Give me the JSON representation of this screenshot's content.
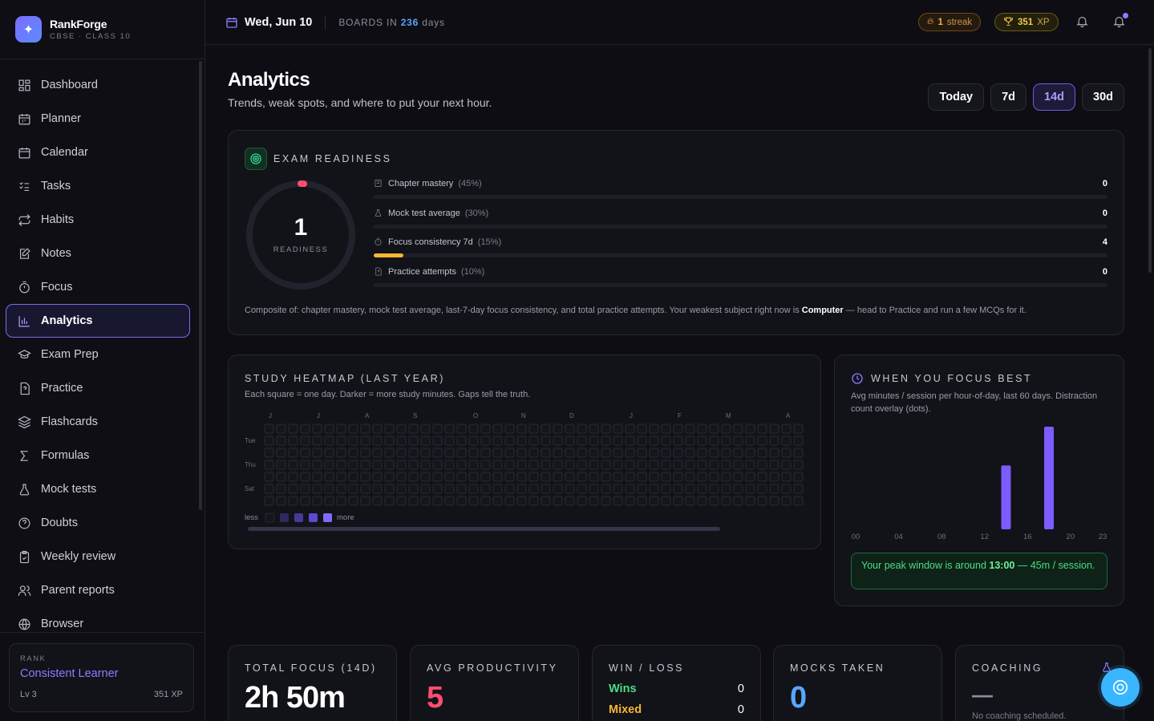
{
  "brand": {
    "name": "RankForge",
    "sub": "CBSE · CLASS 10"
  },
  "sidebar": {
    "items": [
      {
        "label": "Dashboard",
        "icon": "dashboard-icon"
      },
      {
        "label": "Planner",
        "icon": "planner-icon"
      },
      {
        "label": "Calendar",
        "icon": "calendar-icon"
      },
      {
        "label": "Tasks",
        "icon": "tasks-icon"
      },
      {
        "label": "Habits",
        "icon": "habits-icon"
      },
      {
        "label": "Notes",
        "icon": "notes-icon"
      },
      {
        "label": "Focus",
        "icon": "timer-icon"
      },
      {
        "label": "Analytics",
        "icon": "analytics-icon",
        "active": true
      },
      {
        "label": "Exam Prep",
        "icon": "graduation-cap-icon"
      },
      {
        "label": "Practice",
        "icon": "question-file-icon"
      },
      {
        "label": "Flashcards",
        "icon": "layers-icon"
      },
      {
        "label": "Formulas",
        "icon": "sigma-icon"
      },
      {
        "label": "Mock tests",
        "icon": "flask-icon"
      },
      {
        "label": "Doubts",
        "icon": "help-circle-icon"
      },
      {
        "label": "Weekly review",
        "icon": "clipboard-check-icon"
      },
      {
        "label": "Parent reports",
        "icon": "users-icon"
      },
      {
        "label": "Browser",
        "icon": "globe-icon"
      }
    ]
  },
  "rank": {
    "label": "RANK",
    "name": "Consistent Learner",
    "level": "Lv 3",
    "xp": "351 XP"
  },
  "topbar": {
    "date": "Wed, Jun 10",
    "boards_prefix": "BOARDS IN",
    "boards_days": "236",
    "boards_suffix": "days",
    "streak_count": "1",
    "streak_label": "streak",
    "xp_count": "351",
    "xp_label": "XP"
  },
  "page": {
    "title": "Analytics",
    "subtitle": "Trends, weak spots, and where to put your next hour."
  },
  "ranges": [
    {
      "label": "Today",
      "active": false
    },
    {
      "label": "7d",
      "active": false
    },
    {
      "label": "14d",
      "active": true
    },
    {
      "label": "30d",
      "active": false
    }
  ],
  "readiness": {
    "title": "EXAM READINESS",
    "score": "1",
    "score_label": "READINESS",
    "metrics": [
      {
        "label": "Chapter mastery",
        "weight": "(45%)",
        "value": "0",
        "fill": 0
      },
      {
        "label": "Mock test average",
        "weight": "(30%)",
        "value": "0",
        "fill": 0
      },
      {
        "label": "Focus consistency 7d",
        "weight": "(15%)",
        "value": "4",
        "fill": 0.04
      },
      {
        "label": "Practice attempts",
        "weight": "(10%)",
        "value": "0",
        "fill": 0
      }
    ],
    "composite_prefix": "Composite of: chapter mastery, mock test average, last-7-day focus consistency, and total practice attempts. Your weakest subject right now is",
    "weakest": "Computer",
    "composite_suffix": "— head to Practice and run a few MCQs for it.",
    "accent": "#ff4d6d"
  },
  "heatmap": {
    "title": "STUDY HEATMAP (LAST YEAR)",
    "subtitle": "Each square = one day. Darker = more study minutes. Gaps tell the truth.",
    "months": [
      "J",
      "J",
      "A",
      "S",
      "O",
      "N",
      "D",
      "J",
      "F",
      "M",
      "A"
    ],
    "day_labels": [
      "Tue",
      "Thu",
      "Sat"
    ],
    "legend_less": "less",
    "legend_more": "more",
    "legend_colors": [
      "#16161d",
      "#2e2a5e",
      "#443a9a",
      "#5a4ad0",
      "#7c6cff"
    ]
  },
  "focus_best": {
    "title": "WHEN YOU FOCUS BEST",
    "subtitle": "Avg minutes / session per hour-of-day, last 60 days. Distraction count overlay (dots).",
    "peak_prefix": "Your peak window is around",
    "peak_time": "13:00",
    "peak_suffix": "— 45m / session."
  },
  "chart_data": {
    "type": "bar",
    "x": [
      0,
      1,
      2,
      3,
      4,
      5,
      6,
      7,
      8,
      9,
      10,
      11,
      12,
      13,
      14,
      15,
      16,
      17,
      18,
      19,
      20,
      21,
      22,
      23
    ],
    "tick_labels": [
      "00",
      "04",
      "08",
      "12",
      "16",
      "20",
      "23"
    ],
    "values": [
      0,
      0,
      0,
      0,
      0,
      0,
      0,
      0,
      0,
      0,
      0,
      0,
      0,
      0,
      0,
      0,
      0,
      0,
      0,
      0,
      0,
      0,
      0,
      0
    ],
    "series": [
      {
        "values": [
          0,
          0,
          0,
          0,
          0,
          0,
          0,
          0,
          0,
          0,
          0,
          0,
          0,
          0,
          28,
          0,
          0,
          0,
          45,
          0,
          0,
          0,
          0,
          0
        ]
      }
    ],
    "ylim": [
      0,
      45
    ],
    "color": "#7c5cff",
    "grid": false
  },
  "stats": {
    "total_focus": {
      "title": "TOTAL FOCUS (14D)",
      "value": "2h 50m"
    },
    "avg_productivity": {
      "title": "AVG PRODUCTIVITY",
      "value": "5"
    },
    "win_loss": {
      "title": "WIN / LOSS",
      "wins_label": "Wins",
      "wins": "0",
      "mixed_label": "Mixed",
      "mixed": "0"
    },
    "mocks": {
      "title": "MOCKS TAKEN",
      "value": "0"
    },
    "coaching": {
      "title": "COACHING",
      "value": "—",
      "note": "No coaching scheduled."
    }
  }
}
